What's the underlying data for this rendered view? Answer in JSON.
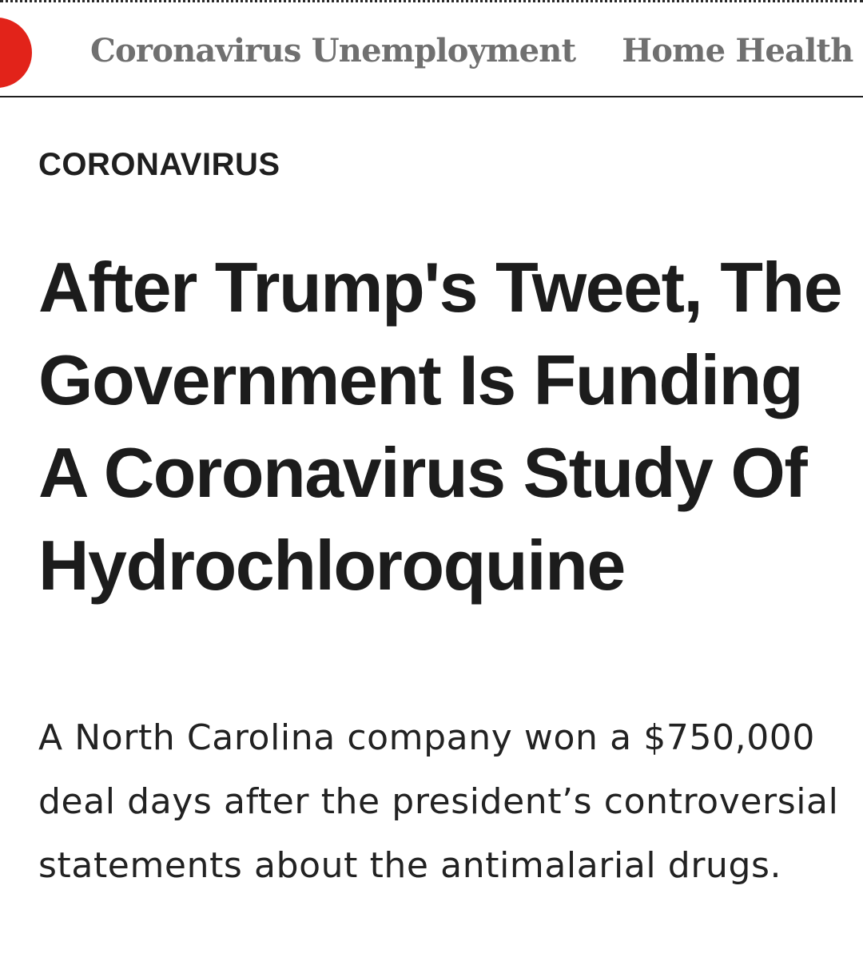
{
  "brand": {
    "accent_color": "#e2231a",
    "logo_icon": "red-circle-logo-icon"
  },
  "nav": {
    "links": [
      {
        "label": "Coronavirus Unemployment"
      },
      {
        "label": "Home Health"
      }
    ]
  },
  "article": {
    "section": "CORONAVIRUS",
    "headline": "After Trump's Tweet, The Government Is Funding A Coronavirus Study Of Hydrochloroquine",
    "dek": "A North Carolina company won a $750,000 deal days after the president’s controversial statements about the antimalarial drugs."
  }
}
